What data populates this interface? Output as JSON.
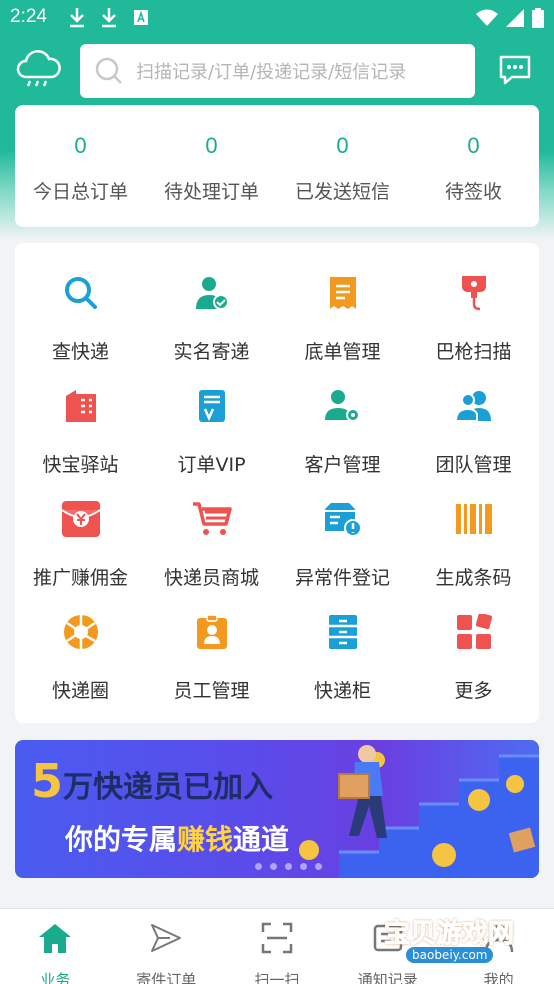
{
  "status_bar": {
    "time": "2:24"
  },
  "header": {
    "search_placeholder": "扫描记录/订单/投递记录/短信记录"
  },
  "stats": [
    {
      "value": "0",
      "label": "今日总订单"
    },
    {
      "value": "0",
      "label": "待处理订单"
    },
    {
      "value": "0",
      "label": "已发送短信"
    },
    {
      "value": "0",
      "label": "待签收"
    }
  ],
  "grid": [
    {
      "label": "查快递",
      "icon": "search-icon",
      "color": "#1a9fd6"
    },
    {
      "label": "实名寄递",
      "icon": "verified-user-icon",
      "color": "#1aab8e"
    },
    {
      "label": "底单管理",
      "icon": "receipt-icon",
      "color": "#f39a1e"
    },
    {
      "label": "巴枪扫描",
      "icon": "scanner-gun-icon",
      "color": "#ef5350"
    },
    {
      "label": "快宝驿站",
      "icon": "building-icon",
      "color": "#ef5350"
    },
    {
      "label": "订单VIP",
      "icon": "vip-document-icon",
      "color": "#1a9fd6"
    },
    {
      "label": "客户管理",
      "icon": "user-settings-icon",
      "color": "#1aab8e"
    },
    {
      "label": "团队管理",
      "icon": "team-icon",
      "color": "#1a9fd6"
    },
    {
      "label": "推广赚佣金",
      "icon": "red-envelope-icon",
      "color": "#ef5350"
    },
    {
      "label": "快递员商城",
      "icon": "shopping-cart-icon",
      "color": "#ef5350"
    },
    {
      "label": "异常件登记",
      "icon": "alert-truck-icon",
      "color": "#1a9fd6"
    },
    {
      "label": "生成条码",
      "icon": "barcode-icon",
      "color": "#f39a1e"
    },
    {
      "label": "快递圈",
      "icon": "aperture-icon",
      "color": "#f39a1e"
    },
    {
      "label": "员工管理",
      "icon": "employee-badge-icon",
      "color": "#f39a1e"
    },
    {
      "label": "快递柜",
      "icon": "cabinet-icon",
      "color": "#1a9fd6"
    },
    {
      "label": "更多",
      "icon": "more-grid-icon",
      "color": "#ef5350"
    }
  ],
  "banner": {
    "line1_num": "5",
    "line1_text": "万快递员已加入",
    "line2_a": "你的专属",
    "line2_hl": "赚钱",
    "line2_b": "通道"
  },
  "tabs": [
    {
      "label": "业务",
      "icon": "home-icon",
      "active": true
    },
    {
      "label": "寄件订单",
      "icon": "send-icon",
      "active": false
    },
    {
      "label": "扫一扫",
      "icon": "scan-frame-icon",
      "active": false
    },
    {
      "label": "通知记录",
      "icon": "notification-icon",
      "active": false
    },
    {
      "label": "我的",
      "icon": "profile-icon",
      "active": false
    }
  ],
  "watermark": {
    "title": "宝贝游戏网",
    "url": "baobeiy.com"
  },
  "colors": {
    "brand": "#1aab8e",
    "header_bg": "#20b99a"
  }
}
